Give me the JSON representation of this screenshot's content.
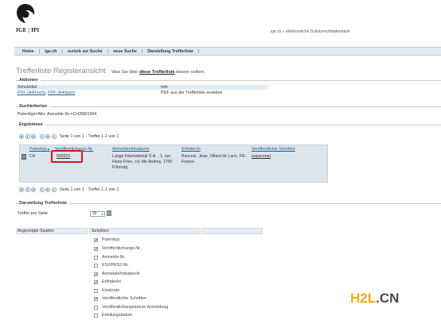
{
  "header": {
    "logo_text": "IGE | IPI",
    "tagline": "ige.ch » elektronische Schutzrechtdatenbank"
  },
  "nav": {
    "items": [
      "Home",
      "ige.ch",
      "zurück zur Suche",
      "neue Suche",
      "Darstellung Trefferliste"
    ],
    "separator": "|"
  },
  "page": {
    "title": "Trefferliste Registeransicht",
    "hint_prefix": "Was Sie über ",
    "hint_link": "diese Trefferliste",
    "hint_suffix": " wissen sollten."
  },
  "aktionen": {
    "title": "Aktionen",
    "col1_header": "Schutztitel",
    "col2_header": "Info",
    "pdf_portrait": "PDF (A4/hoch)",
    "comma": ",",
    "pdf_landscape": "PDF (A4/quer)",
    "info_text": "PDF aus der Trefferliste erstellen"
  },
  "suchkriterien": {
    "title": "Suchkriterien",
    "text": "Patenttyp=Alle; Anmelde-Nr.=CH358/1994"
  },
  "ergebnisse": {
    "title": "Ergebnisse",
    "pager_text": "Seite 1 von 1 - Treffer 1-1 von 1",
    "columns": [
      "Patenttyp",
      "Veröffentlichungs-Nr.",
      "Anmelder/Inhaber/in",
      "Erfinder/in",
      "Veröffentlichte Schriften"
    ],
    "sort_arrow": "▲",
    "row": {
      "type": "CH",
      "pub_no": "689533",
      "applicant": "Lange International S.A. , 1, rue Hans-Fries, c/o Me Andrey, 1700 Fribourg",
      "inventor": "Bauvois, Jean, Villard de Lans, FR-France",
      "docs": "espacenet"
    }
  },
  "darstellung": {
    "title": "Darstellung Trefferliste",
    "per_page_label": "Treffer pro Seite",
    "per_page_value": "25",
    "select_arrow": "▼",
    "columns_label": "Angezeigte Spalten",
    "selection_label": "Selektion",
    "check_mark": "✔",
    "options": [
      {
        "label": "Patenttyp",
        "checked": true
      },
      {
        "label": "Veröffentlichungs-Nr.",
        "checked": true
      },
      {
        "label": "Anmelde-Nr.",
        "checked": false
      },
      {
        "label": "ES2/PES2-Nr.",
        "checked": false
      },
      {
        "label": "Anmelder/Inhaber/in",
        "checked": true
      },
      {
        "label": "Erfinder/in",
        "checked": true
      },
      {
        "label": "Kindcode",
        "checked": false
      },
      {
        "label": "Veröffentlichte Schriften",
        "checked": true
      },
      {
        "label": "Veröffentlichungsdatum Anmeldung",
        "checked": false
      },
      {
        "label": "Erteilungsdatum",
        "checked": false
      }
    ]
  },
  "watermark": {
    "part1": "H2L",
    "part2": ".",
    "part3": "CN"
  },
  "colors": {
    "brand": "#1a1a1a",
    "highlight": "#e0141a",
    "band": "#e3ecf4"
  }
}
